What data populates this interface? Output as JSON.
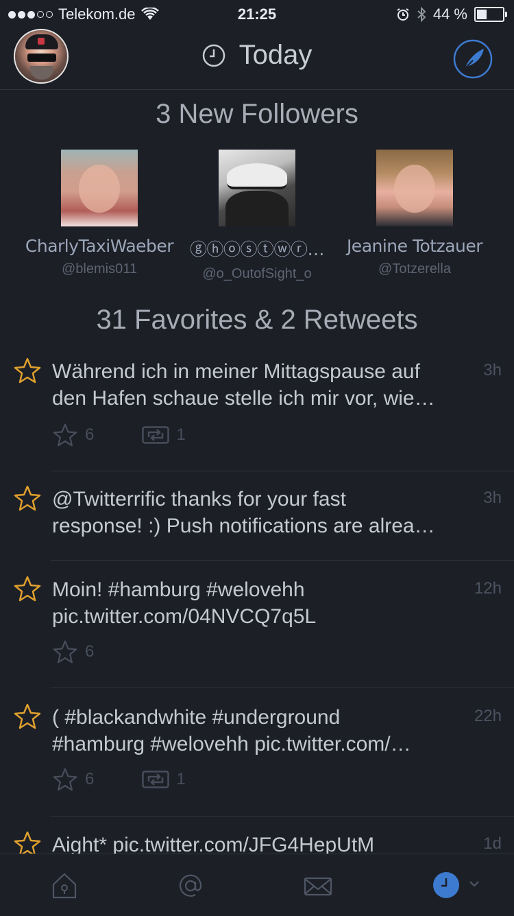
{
  "status_bar": {
    "carrier": "Telekom.de",
    "time": "21:25",
    "battery": "44 %",
    "battery_level": 0.44
  },
  "nav": {
    "title": "Today"
  },
  "followers_section": {
    "title": "3 New Followers",
    "followers": [
      {
        "name": "CharlyTaxiWaeber",
        "handle": "@blemis011"
      },
      {
        "name": "ⓖⓗⓞⓢⓣⓦⓡ…",
        "handle": "@o_OutofSight_o"
      },
      {
        "name": "Jeanine Totzauer",
        "handle": "@Totzerella"
      }
    ]
  },
  "activity_section": {
    "title": "31 Favorites & 2 Retweets"
  },
  "tweets": [
    {
      "line1": "Während ich in meiner Mittagspause auf",
      "line2": "den Hafen schaue stelle ich mir vor, wie…",
      "age": "3h",
      "favorites": "6",
      "retweets": "1"
    },
    {
      "line1": "@Twitterrific thanks for your fast",
      "line2": "response! :) Push notifications are alrea…",
      "age": "3h"
    },
    {
      "line1": "Moin! #hamburg #welovehh",
      "line2": "pic.twitter.com/04NVCQ7q5L",
      "age": "12h",
      "favorites": "6"
    },
    {
      "line1": "( #blackandwhite #underground",
      "line2": "#hamburg #welovehh pic.twitter.com/…",
      "age": "22h",
      "favorites": "6",
      "retweets": "1"
    },
    {
      "line1": "Aight* pic.twitter.com/JFG4HepUtM",
      "age": "1d"
    }
  ],
  "tabbar": {
    "tabs": [
      "home-icon",
      "mentions-icon",
      "messages-icon",
      "today-icon"
    ],
    "active": "today-icon"
  },
  "colors": {
    "background": "#1c1f26",
    "accent": "#3d7bd1",
    "star": "#e0a02e"
  }
}
